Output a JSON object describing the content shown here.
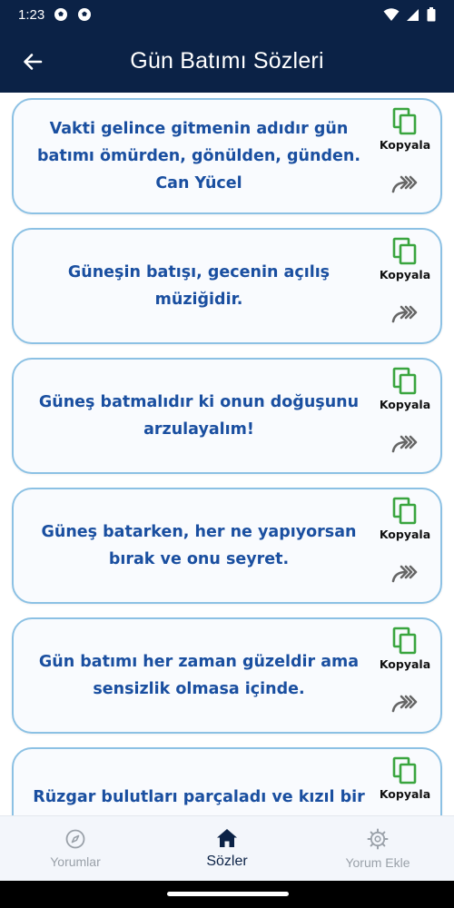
{
  "status_bar": {
    "time": "1:23",
    "icons": [
      "soccer-ball-icon",
      "soccer-ball-icon",
      "wifi-icon",
      "signal-icon",
      "battery-icon"
    ]
  },
  "app_bar": {
    "title": "Gün Batımı Sözleri",
    "back_icon": "arrow-left-icon"
  },
  "colors": {
    "header_bg": "#0b2246",
    "card_border": "#8cc1e4",
    "quote_text": "#1a4fa0",
    "copy_icon": "#3aa53f",
    "share_icon": "#666666"
  },
  "cards": [
    {
      "text": "Vakti gelince gitmenin adıdır gün batımı ömürden, gönülden, günden. Can Yücel",
      "copy_label": "Kopyala"
    },
    {
      "text": "Güneşin batışı, gecenin açılış müziğidir.",
      "copy_label": "Kopyala"
    },
    {
      "text": "Güneş batmalıdır ki onun doğuşunu arzulayalım!",
      "copy_label": "Kopyala"
    },
    {
      "text": "Güneş batarken, her ne yapıyorsan bırak ve onu seyret.",
      "copy_label": "Kopyala"
    },
    {
      "text": "Gün batımı her zaman güzeldir ama sensizlik olmasa içinde.",
      "copy_label": "Kopyala"
    },
    {
      "text": "Rüzgar bulutları parçaladı ve kızıl bir",
      "copy_label": "Kopyala"
    }
  ],
  "bottom_nav": {
    "items": [
      {
        "label": "Yorumlar",
        "icon": "compass-icon",
        "active": false
      },
      {
        "label": "Sözler",
        "icon": "home-icon",
        "active": true
      },
      {
        "label": "Yorum Ekle",
        "icon": "gear-icon",
        "active": false
      }
    ]
  }
}
